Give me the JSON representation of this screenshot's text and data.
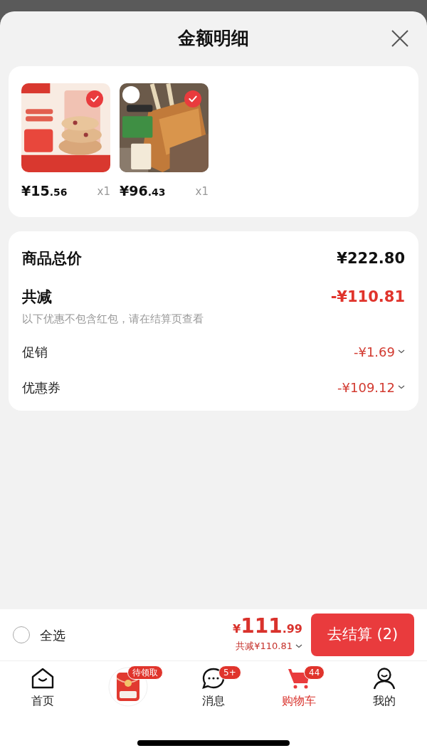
{
  "sheet": {
    "title": "金额明细"
  },
  "products": [
    {
      "price": "¥15.56",
      "qty": "x1",
      "selected": true,
      "kind": "picture"
    },
    {
      "price": "¥96.43",
      "qty": "x1",
      "selected": true,
      "kind": "picture"
    }
  ],
  "summary": {
    "total_label": "商品总价",
    "total_value": "¥222.80",
    "discount_label": "共减",
    "discount_value": "-¥110.81",
    "note": "以下优惠不包含红包，请在结算页查看",
    "items": [
      {
        "label": "促销",
        "value": "-¥1.69"
      },
      {
        "label": "优惠券",
        "value": "-¥109.12"
      }
    ]
  },
  "checkout_bar": {
    "select_all_label": "全选",
    "select_all_checked": false,
    "total": "¥111.99",
    "saved": "共减¥110.81",
    "button": "去结算 (2)"
  },
  "tab_bar": [
    {
      "kind": "home",
      "label": "首页",
      "selected": false
    },
    {
      "kind": "promo",
      "badge": "待领取",
      "selected": false
    },
    {
      "kind": "messages",
      "label": "消息",
      "badge": "5+",
      "selected": false
    },
    {
      "kind": "cart",
      "label": "购物车",
      "badge": "44",
      "selected": true
    },
    {
      "kind": "profile",
      "label": "我的",
      "selected": false
    }
  ]
}
